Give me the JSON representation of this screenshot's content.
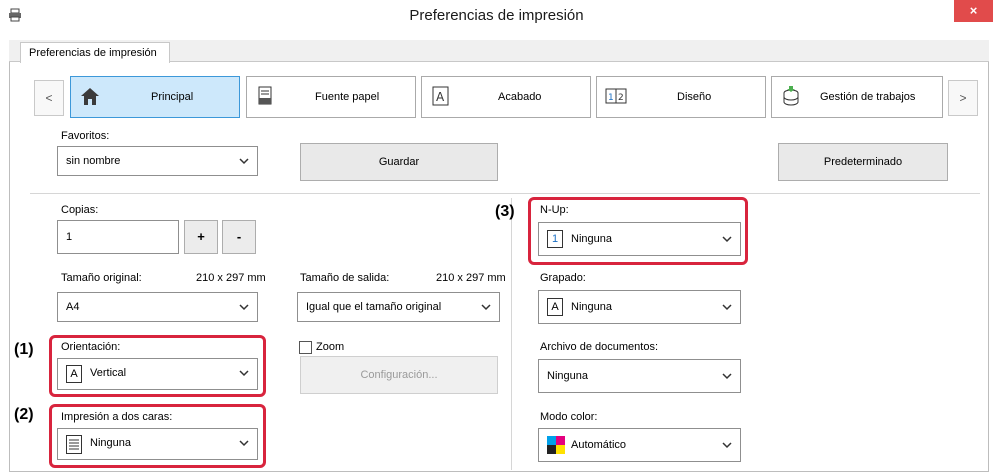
{
  "window": {
    "title": "Preferencias de impresión",
    "close_glyph": "×"
  },
  "tab": {
    "label": "Preferencias de impresión"
  },
  "nav": {
    "prev": "<",
    "next": ">",
    "items": [
      {
        "label": "Principal",
        "icon": "home-icon"
      },
      {
        "label": "Fuente papel",
        "icon": "paper-tray-icon"
      },
      {
        "label": "Acabado",
        "icon": "finishing-icon"
      },
      {
        "label": "Diseño",
        "icon": "layout-icon"
      },
      {
        "label": "Gestión de trabajos",
        "icon": "job-storage-icon"
      }
    ]
  },
  "favoritos": {
    "label": "Favoritos:",
    "value": "sin nombre"
  },
  "buttons": {
    "guardar": "Guardar",
    "predeterminado": "Predeterminado",
    "configuracion": "Configuración...",
    "plus": "+",
    "minus": "-"
  },
  "copias": {
    "label": "Copias:",
    "value": "1"
  },
  "tamano_original": {
    "label": "Tamaño original:",
    "size": "210 x 297 mm",
    "value": "A4"
  },
  "tamano_salida": {
    "label": "Tamaño de salida:",
    "size": "210 x 297 mm",
    "value": "Igual que el tamaño original"
  },
  "orientacion": {
    "label": "Orientación:",
    "value": "Vertical",
    "icon_glyph": "A"
  },
  "zoom": {
    "label": "Zoom"
  },
  "dos_caras": {
    "label": "Impresión a dos caras:",
    "value": "Ninguna"
  },
  "nup": {
    "label": "N-Up:",
    "value": "Ninguna",
    "icon_glyph": "1"
  },
  "grapado": {
    "label": "Grapado:",
    "value": "Ninguna",
    "icon_glyph": "A"
  },
  "archivo": {
    "label": "Archivo de documentos:",
    "value": "Ninguna"
  },
  "modo_color": {
    "label": "Modo color:",
    "value": "Automático"
  },
  "callouts": {
    "c1": "(1)",
    "c2": "(2)",
    "c3": "(3)"
  },
  "colors": {
    "highlight": "#d8243d",
    "active_tab": "#cde8fb",
    "close": "#e14b4b"
  }
}
